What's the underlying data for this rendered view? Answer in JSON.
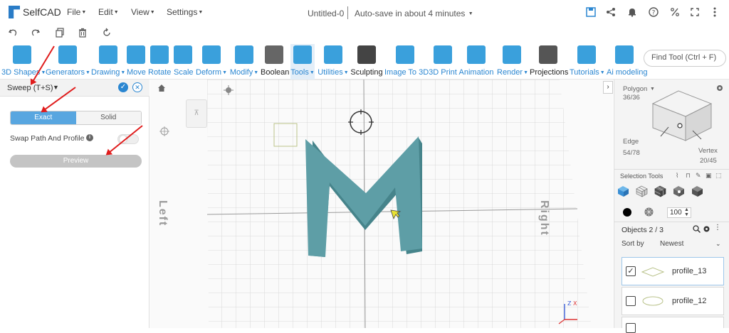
{
  "app": {
    "name": "SelfCAD"
  },
  "menu": {
    "file": "File",
    "edit": "Edit",
    "view": "View",
    "settings": "Settings"
  },
  "doc": {
    "title": "Untitled-0",
    "autosave": "Auto-save in about 4 minutes"
  },
  "toolbar": [
    {
      "label": "3D Shapes",
      "caret": true,
      "color": "#3aa0dc"
    },
    {
      "label": "Generators",
      "caret": true,
      "color": "#3aa0dc"
    },
    {
      "label": "Drawing",
      "caret": true,
      "color": "#3aa0dc"
    },
    {
      "label": "Move",
      "caret": false,
      "color": "#3aa0dc"
    },
    {
      "label": "Rotate",
      "caret": false,
      "color": "#3aa0dc"
    },
    {
      "label": "Scale",
      "caret": false,
      "color": "#3aa0dc"
    },
    {
      "label": "Deform",
      "caret": true,
      "color": "#3aa0dc"
    },
    {
      "label": "Modify",
      "caret": true,
      "color": "#3aa0dc"
    },
    {
      "label": "Boolean",
      "caret": false,
      "color": "#666"
    },
    {
      "label": "Tools",
      "caret": true,
      "color": "#3aa0dc"
    },
    {
      "label": "Utilities",
      "caret": true,
      "color": "#3aa0dc"
    },
    {
      "label": "Sculpting",
      "caret": false,
      "color": "#444"
    },
    {
      "label": "Image To 3D",
      "caret": false,
      "color": "#3aa0dc"
    },
    {
      "label": "3D Print",
      "caret": false,
      "color": "#3aa0dc"
    },
    {
      "label": "Animation",
      "caret": false,
      "color": "#3aa0dc"
    },
    {
      "label": "Render",
      "caret": true,
      "color": "#3aa0dc"
    },
    {
      "label": "Projections",
      "caret": false,
      "color": "#555"
    },
    {
      "label": "Tutorials",
      "caret": true,
      "color": "#3aa0dc"
    },
    {
      "label": "Ai modeling",
      "caret": false,
      "color": "#3aa0dc"
    }
  ],
  "find_tool": {
    "placeholder": "Find Tool (Ctrl + F)"
  },
  "sweep": {
    "title": "Sweep (T+S)",
    "exact": "Exact",
    "solid": "Solid",
    "swap_label": "Swap Path And Profile",
    "preview": "Preview"
  },
  "viewport": {
    "left_label": "Left",
    "right_label": "Right",
    "letter": "M",
    "axis_x": "X",
    "axis_z": "Z",
    "model_color": "#5e9ea6"
  },
  "cube_nav": {
    "polygon_label": "Polygon",
    "polygon_count": "36/36",
    "edge_label": "Edge",
    "edge_count": "54/78",
    "vertex_label": "Vertex",
    "vertex_count": "20/45"
  },
  "selection": {
    "title": "Selection Tools",
    "opacity": "100"
  },
  "objects": {
    "title": "Objects 2 / 3",
    "sort_label": "Sort by",
    "sort_value": "Newest",
    "items": [
      {
        "name": "profile_13",
        "checked": true
      },
      {
        "name": "profile_12",
        "checked": false
      }
    ]
  }
}
